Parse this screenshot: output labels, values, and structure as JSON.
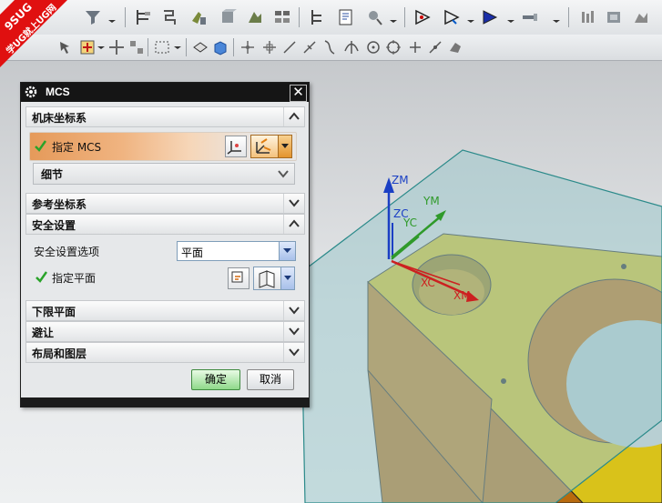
{
  "watermark": {
    "top_text": "9SUG",
    "bottom_text": "学UG就上UG网"
  },
  "dialog": {
    "title": "MCS",
    "sections": {
      "machine_csys": "机床坐标系",
      "specify_mcs": "指定 MCS",
      "detail": "细节",
      "reference_csys": "参考坐标系",
      "safety_settings": "安全设置",
      "safety_option_label": "安全设置选项",
      "safety_option_value": "平面",
      "specify_plane": "指定平面",
      "lower_limit_plane": "下限平面",
      "avoidance": "避让",
      "layout_layers": "布局和图层"
    },
    "buttons": {
      "ok": "确定",
      "cancel": "取消"
    }
  },
  "viewport": {
    "axis_labels": {
      "zm": "ZM",
      "zc": "ZC",
      "ym": "YM",
      "yc": "YC",
      "xc": "XC",
      "xm": "XM"
    }
  },
  "colors": {
    "part_top": "#d9c21a",
    "part_side": "#b86a0e",
    "plane_fill": "#9fc9cc",
    "plane_edge": "#2b8a8a",
    "z_axis": "#1b3fc4",
    "y_axis": "#2f9a2a",
    "x_axis": "#cc2020",
    "accent_orange": "#e59a5a"
  }
}
